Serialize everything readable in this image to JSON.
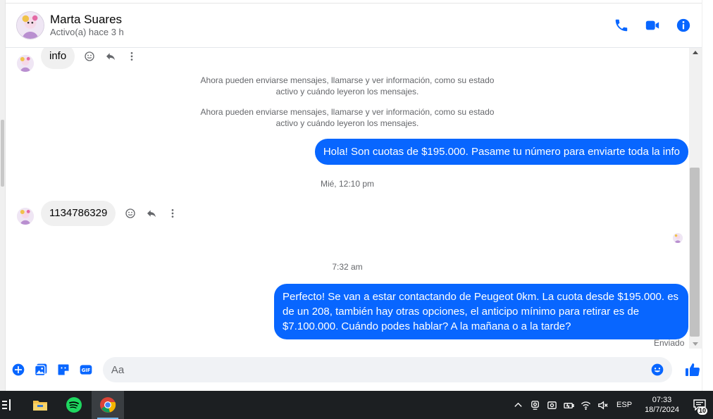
{
  "header": {
    "name": "Marta Suares",
    "status": "Activo(a) hace 3 h",
    "icons": [
      "phone-icon",
      "video-camera-icon",
      "info-icon"
    ]
  },
  "thread": {
    "partial_message": "info",
    "system_notice_1": "Ahora pueden enviarse mensajes, llamarse y ver información, como su estado activo y cuándo leyeron los mensajes.",
    "system_notice_2": "Ahora pueden enviarse mensajes, llamarse y ver información, como su estado activo y cuándo leyeron los mensajes.",
    "out_message_1": "Hola! Son cuotas de $195.000. Pasame tu número para enviarte toda la info",
    "timestamp_1": "Mié, 12:10 pm",
    "in_message_1": "1134786329",
    "timestamp_2": "7:32 am",
    "out_message_2": "Perfecto!  Se van a estar contactando de Peugeot 0km. La cuota desde $195.000. es de un 208, también hay otras opciones, el anticipo mínimo para retirar es de $7.100.000. Cuándo podes hablar? A la mañana o a la tarde?",
    "sent_status": "Enviado"
  },
  "composer": {
    "placeholder": "Aa",
    "value": ""
  },
  "taskbar": {
    "language": "ESP",
    "time": "07:33",
    "date": "18/7/2024",
    "notification_count": "10"
  },
  "colors": {
    "accent": "#0866ff",
    "incoming_bubble": "#f0f0f0",
    "taskbar": "#1c1f22"
  }
}
